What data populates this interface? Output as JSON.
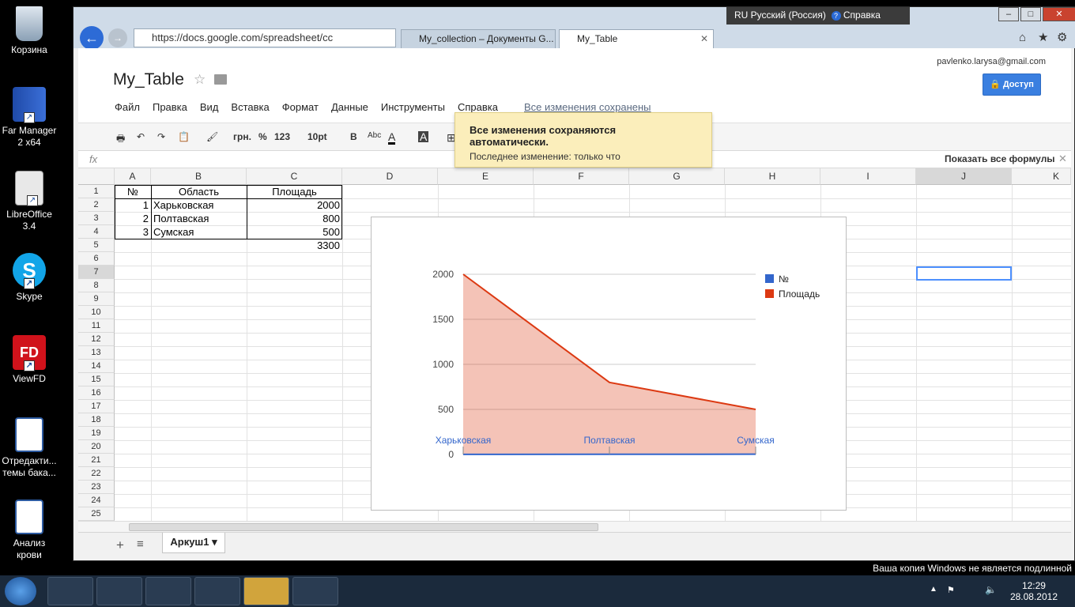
{
  "desktop": {
    "icons": [
      {
        "label": "Корзина"
      },
      {
        "label": "Far Manager 2 x64"
      },
      {
        "label": "LibreOffice 3.4"
      },
      {
        "label": "Skype"
      },
      {
        "label": "ViewFD"
      },
      {
        "label": "Отредакти... темы бака..."
      },
      {
        "label": "Анализ крови"
      }
    ],
    "windows_notice": "Ваша копия Windows не является подлинной"
  },
  "browser": {
    "address": "https://docs.google.com/spreadsheet/cc",
    "tabs": [
      {
        "label": "My_collection – Документы G..."
      },
      {
        "label": "My_Table"
      }
    ],
    "language": "RU Русский (Россия)",
    "help": "Справка"
  },
  "docs": {
    "title": "My_Table",
    "account": "pavlenko.larysa@gmail.com",
    "share_label": "Доступ",
    "menu": [
      "Файл",
      "Правка",
      "Вид",
      "Вставка",
      "Формат",
      "Данные",
      "Инструменты",
      "Справка"
    ],
    "saved_status": "Все изменения сохранены",
    "toolbar": {
      "currency": "грн.",
      "percent": "%",
      "number_format": "123",
      "font_size": "10pt",
      "bold": "B",
      "strike": "Abc",
      "text_color": "A",
      "fill": "A"
    },
    "popup": {
      "title": "Все изменения сохраняются автоматически.",
      "subtitle": "Последнее изменение: только что"
    },
    "formula_bar": {
      "fx": "fx",
      "show_all": "Показать все формулы"
    },
    "columns": [
      "A",
      "B",
      "C",
      "D",
      "E",
      "F",
      "G",
      "H",
      "I",
      "J",
      "K"
    ],
    "rows": [
      "1",
      "2",
      "3",
      "4",
      "5",
      "6",
      "7",
      "8",
      "9",
      "10",
      "11",
      "12",
      "13",
      "14",
      "15",
      "16",
      "17",
      "18",
      "19",
      "20",
      "21",
      "22",
      "23",
      "24",
      "25"
    ],
    "table": {
      "header": [
        "№",
        "Область",
        "Площадь"
      ],
      "rows": [
        [
          "1",
          "Харьковская",
          "2000"
        ],
        [
          "2",
          "Полтавская",
          "800"
        ],
        [
          "3",
          "Сумская",
          "500"
        ]
      ],
      "total": "3300"
    },
    "sheet_tab": "Аркуш1"
  },
  "chart_data": {
    "type": "area",
    "categories": [
      "Харьковская",
      "Полтавская",
      "Сумская"
    ],
    "series": [
      {
        "name": "№",
        "values": [
          1,
          2,
          3
        ],
        "color": "#3366cc"
      },
      {
        "name": "Площадь",
        "values": [
          2000,
          800,
          500
        ],
        "color": "#dc3912"
      }
    ],
    "yticks": [
      "2000",
      "1500",
      "1000",
      "500",
      "0"
    ],
    "ylim": [
      0,
      2000
    ],
    "legend": "right"
  },
  "taskbar": {
    "time": "12:29",
    "date": "28.08.2012"
  }
}
